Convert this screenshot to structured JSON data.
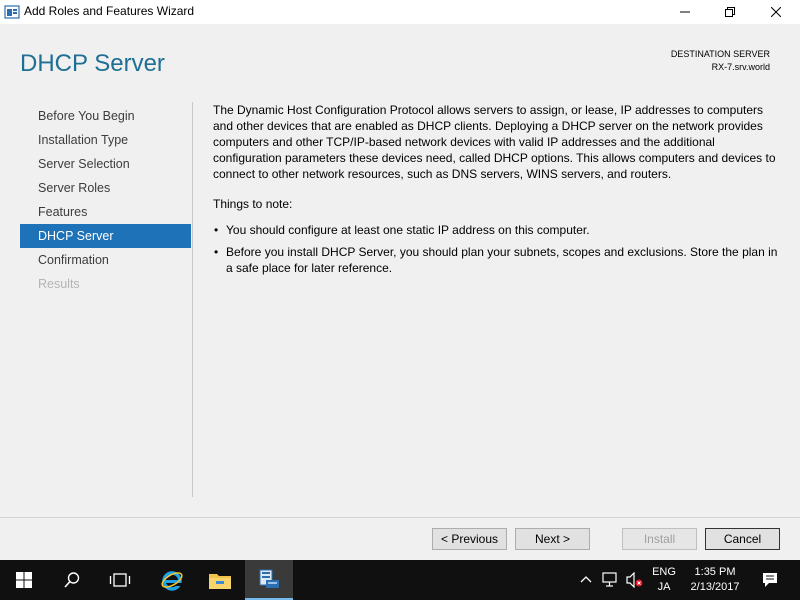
{
  "window": {
    "title": "Add Roles and Features Wizard"
  },
  "header": {
    "page_title": "DHCP Server",
    "destination_label": "DESTINATION SERVER",
    "destination_server": "RX-7.srv.world"
  },
  "nav": {
    "items": [
      {
        "label": "Before You Begin",
        "state": "normal"
      },
      {
        "label": "Installation Type",
        "state": "normal"
      },
      {
        "label": "Server Selection",
        "state": "normal"
      },
      {
        "label": "Server Roles",
        "state": "normal"
      },
      {
        "label": "Features",
        "state": "normal"
      },
      {
        "label": "DHCP Server",
        "state": "active"
      },
      {
        "label": "Confirmation",
        "state": "normal"
      },
      {
        "label": "Results",
        "state": "disabled"
      }
    ]
  },
  "content": {
    "description": "The Dynamic Host Configuration Protocol allows servers to assign, or lease, IP addresses to computers and other devices that are enabled as DHCP clients. Deploying a DHCP server on the network provides computers and other TCP/IP-based network devices with valid IP addresses and the additional configuration parameters these devices need, called DHCP options. This allows computers and devices to connect to other network resources, such as DNS servers, WINS servers, and routers.",
    "notes_title": "Things to note:",
    "notes": [
      "You should configure at least one static IP address on this computer.",
      "Before you install DHCP Server, you should plan your subnets, scopes and exclusions. Store the plan in a safe place for later reference."
    ]
  },
  "buttons": {
    "previous": "< Previous",
    "next": "Next >",
    "install": "Install",
    "cancel": "Cancel"
  },
  "taskbar": {
    "language_top": "ENG",
    "language_bottom": "JA",
    "time": "1:35 PM",
    "date": "2/13/2017",
    "icons": [
      "start-icon",
      "search-icon",
      "task-view-icon",
      "ie-icon",
      "file-explorer-icon",
      "server-manager-icon"
    ]
  },
  "colors": {
    "accent": "#1e72b8",
    "title_blue": "#1e6f93",
    "taskbar": "#101010"
  }
}
